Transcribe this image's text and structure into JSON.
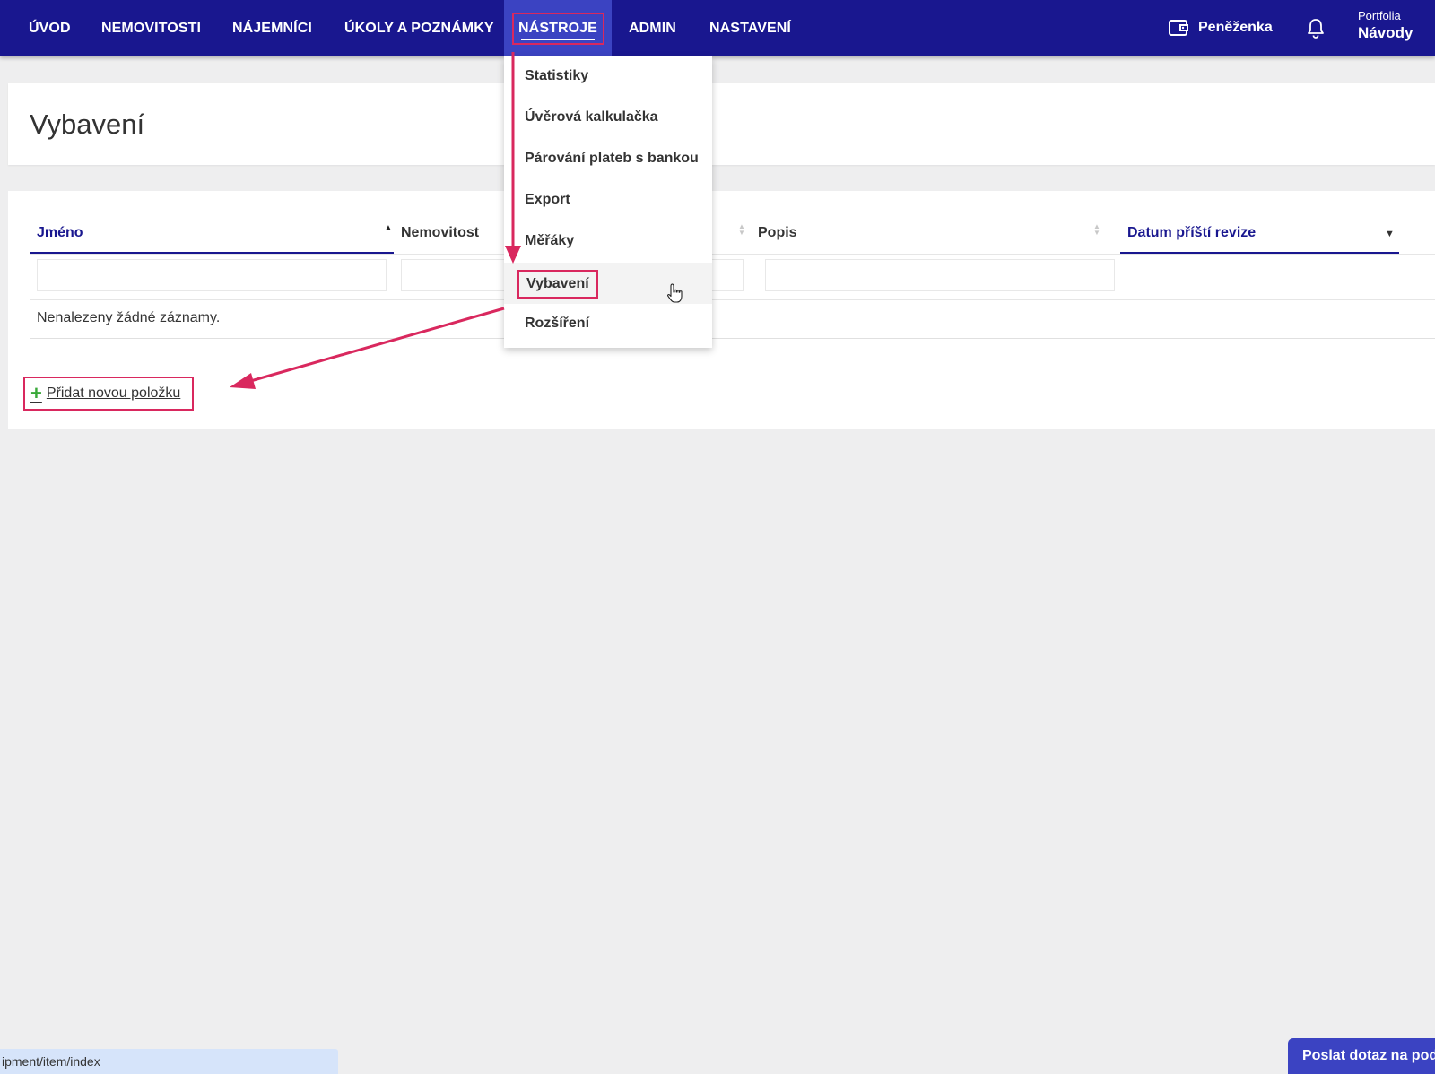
{
  "nav": {
    "items": [
      "ÚVOD",
      "NEMOVITOSTI",
      "NÁJEMNÍCI",
      "ÚKOLY A POZNÁMKY",
      "NÁSTROJE",
      "ADMIN",
      "NASTAVENÍ"
    ],
    "active_index": 4,
    "wallet_label": "Peněženka",
    "wallet_icon": "wallet-icon",
    "bell_icon": "bell-icon",
    "portfolio_label": "Portfolia",
    "portfolio_name": "Návody"
  },
  "page": {
    "title": "Vybavení"
  },
  "dropdown": {
    "items": [
      "Statistiky",
      "Úvěrová kalkulačka",
      "Párování plateb s bankou",
      "Export",
      "Měřáky",
      "Vybavení",
      "Rozšíření"
    ],
    "hovered_index": 5
  },
  "table": {
    "columns": [
      "Jméno",
      "Nemovitost",
      "Popis",
      "Datum příští revize"
    ],
    "empty_message": "Nenalezeny žádné záznamy.",
    "add_label": "Přidat novou položku",
    "add_icon": "plus-icon"
  },
  "status_bar": {
    "url": "ipment/item/index"
  },
  "chat": {
    "label": "Poslat dotaz na podp"
  },
  "colors": {
    "nav_bg": "#19178f",
    "nav_active_bg": "#3b43c2",
    "highlight": "#d9285e",
    "page_bg": "#eeeeef"
  }
}
